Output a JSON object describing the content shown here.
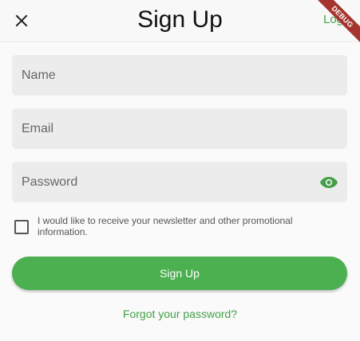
{
  "app_bar": {
    "title": "Sign Up",
    "login_label": "Log",
    "close_icon": "close-icon"
  },
  "debug_banner": "DEBUG",
  "form": {
    "name_placeholder": "Name",
    "email_placeholder": "Email",
    "password_placeholder": "Password",
    "password_toggle_icon": "eye-icon",
    "newsletter_label": "I would like to receive your newsletter and other promotional information.",
    "newsletter_checked": false,
    "signup_label": "Sign Up",
    "forgot_label": "Forgot your password?"
  },
  "colors": {
    "accent": "#4caf50",
    "link": "#43a047",
    "debug_banner": "#a5342e"
  }
}
